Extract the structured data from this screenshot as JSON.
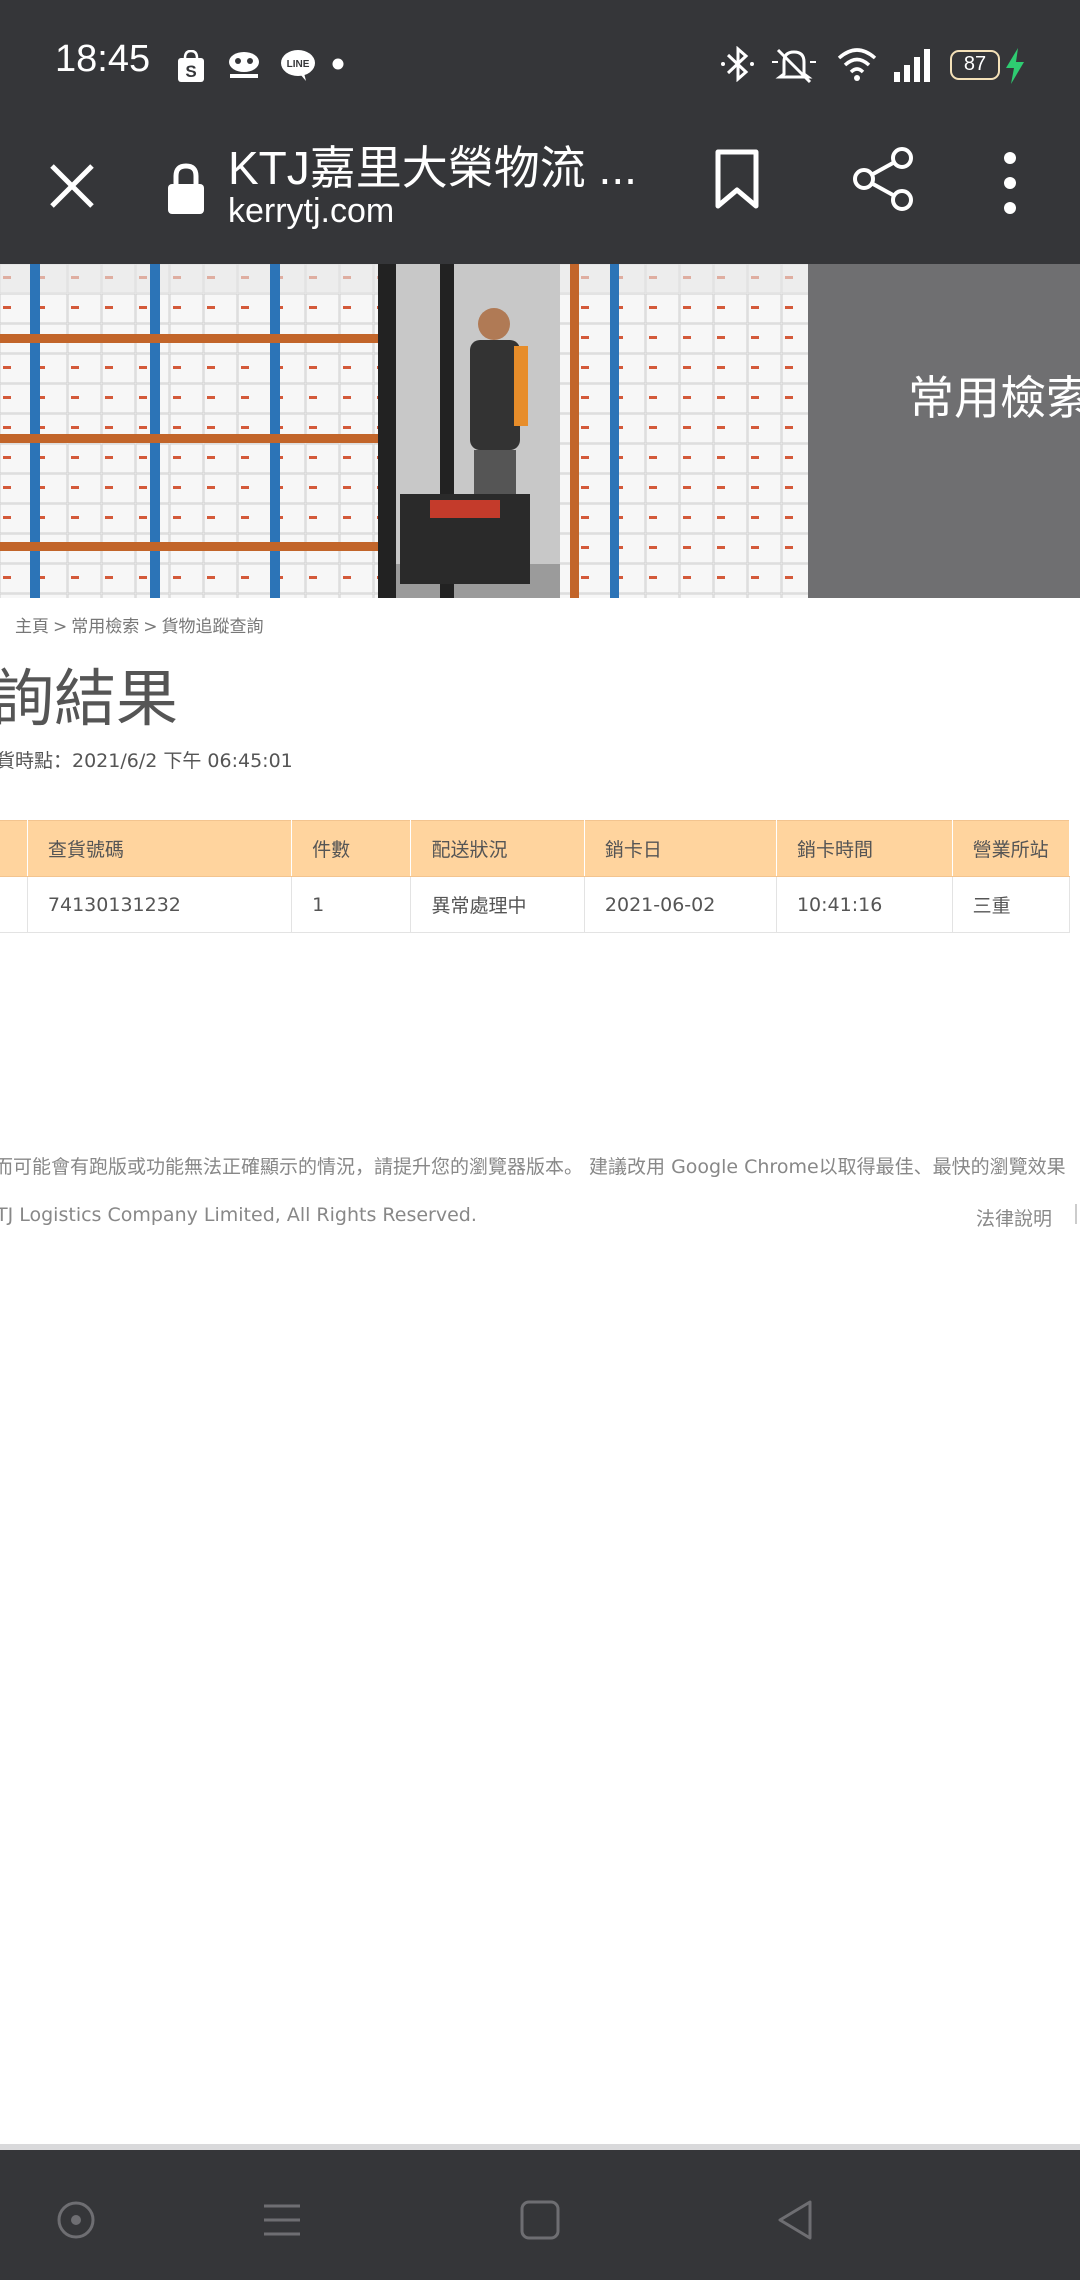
{
  "status_bar": {
    "time": "18:45",
    "battery": "87",
    "icons": [
      "shopee-icon",
      "gomaji-icon",
      "line-icon",
      "dot-icon",
      "bluetooth-icon",
      "mute-icon",
      "wifi-icon",
      "signal-icon",
      "battery-icon",
      "charging-icon"
    ]
  },
  "browser": {
    "title": "KTJ嘉里大榮物流 ...",
    "url": "kerrytj.com"
  },
  "banner": {
    "text": "常用檢索"
  },
  "breadcrumb": {
    "prefix": "：",
    "items": [
      "主頁",
      "常用檢索",
      "貨物追蹤查詢"
    ],
    "separator": ">"
  },
  "result_title": "詢結果",
  "query_time": "貨時點：2021/6/2 下午 06:45:01",
  "table": {
    "headers": [
      "",
      "查貨號碼",
      "件數",
      "配送狀況",
      "銷卡日",
      "銷卡時間",
      "營業所站"
    ],
    "rows": [
      [
        "",
        "74130131232",
        "1",
        "異常處理中",
        "2021-06-02",
        "10:41:16",
        "三重"
      ]
    ]
  },
  "footer": {
    "notice": "而可能會有跑版或功能無法正確顯示的情況，請提升您的瀏覽器版本。 建議改用 Google Chrome以取得最佳、最快的瀏覽效果",
    "copyright": "TJ Logistics Company Limited, All Rights Reserved.",
    "legal": "法律說明"
  },
  "colors": {
    "chrome": "#353639",
    "table_header": "#ffd49e",
    "charging": "#2ecc71"
  }
}
